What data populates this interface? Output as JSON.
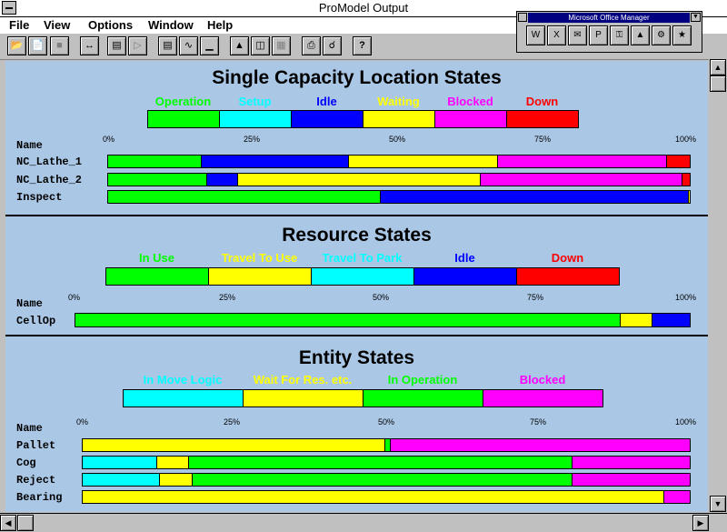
{
  "window": {
    "title": "ProModel Output"
  },
  "menu": [
    "File",
    "View",
    "Options",
    "Window",
    "Help"
  ],
  "office_manager": {
    "title": "Microsoft Office Manager"
  },
  "colors": {
    "green": "#00ff00",
    "cyan": "#00ffff",
    "blue": "#0000ff",
    "yellow": "#ffff00",
    "magenta": "#ff00ff",
    "red": "#ff0000"
  },
  "ticks": [
    "0%",
    "25%",
    "50%",
    "75%",
    "100%"
  ],
  "name_header": "Name",
  "chart_data": [
    {
      "type": "bar",
      "title": "Single Capacity Location States",
      "legend": [
        {
          "name": "Operation",
          "color": "#00ff00"
        },
        {
          "name": "Setup",
          "color": "#00ffff"
        },
        {
          "name": "Idle",
          "color": "#0000ff"
        },
        {
          "name": "Waiting",
          "color": "#ffff00"
        },
        {
          "name": "Blocked",
          "color": "#ff00ff"
        },
        {
          "name": "Down",
          "color": "#ff0000"
        }
      ],
      "rows": [
        {
          "name": "NC_Lathe_1",
          "values": [
            16,
            0,
            25.3,
            25.6,
            29,
            4.1
          ]
        },
        {
          "name": "NC_Lathe_2",
          "values": [
            16.8,
            0,
            5.4,
            41.7,
            34.7,
            1.4
          ]
        },
        {
          "name": "Inspect",
          "values": [
            46.7,
            0,
            53,
            0.3,
            0,
            0
          ]
        }
      ]
    },
    {
      "type": "bar",
      "title": "Resource States",
      "legend": [
        {
          "name": "In Use",
          "color": "#00ff00"
        },
        {
          "name": "Travel To Use",
          "color": "#ffff00"
        },
        {
          "name": "Travel To Park",
          "color": "#00ffff"
        },
        {
          "name": "Idle",
          "color": "#0000ff"
        },
        {
          "name": "Down",
          "color": "#ff0000"
        }
      ],
      "rows": [
        {
          "name": "CellOp",
          "values": [
            88.6,
            5.2,
            0,
            6.2,
            0
          ]
        }
      ]
    },
    {
      "type": "bar",
      "title": "Entity States",
      "legend": [
        {
          "name": "In Move Logic",
          "color": "#00ffff"
        },
        {
          "name": "Wait For Res. etc.",
          "color": "#ffff00"
        },
        {
          "name": "In Operation",
          "color": "#00ff00"
        },
        {
          "name": "Blocked",
          "color": "#ff00ff"
        }
      ],
      "rows": [
        {
          "name": "Pallet",
          "values": [
            0,
            49.7,
            0.9,
            49.4
          ]
        },
        {
          "name": "Cog",
          "values": [
            12.2,
            5.2,
            63.2,
            19.4
          ]
        },
        {
          "name": "Reject",
          "values": [
            12.6,
            5.4,
            62.6,
            19.4
          ]
        },
        {
          "name": "Bearing",
          "values": [
            0,
            95.7,
            0,
            4.3
          ]
        }
      ]
    }
  ]
}
